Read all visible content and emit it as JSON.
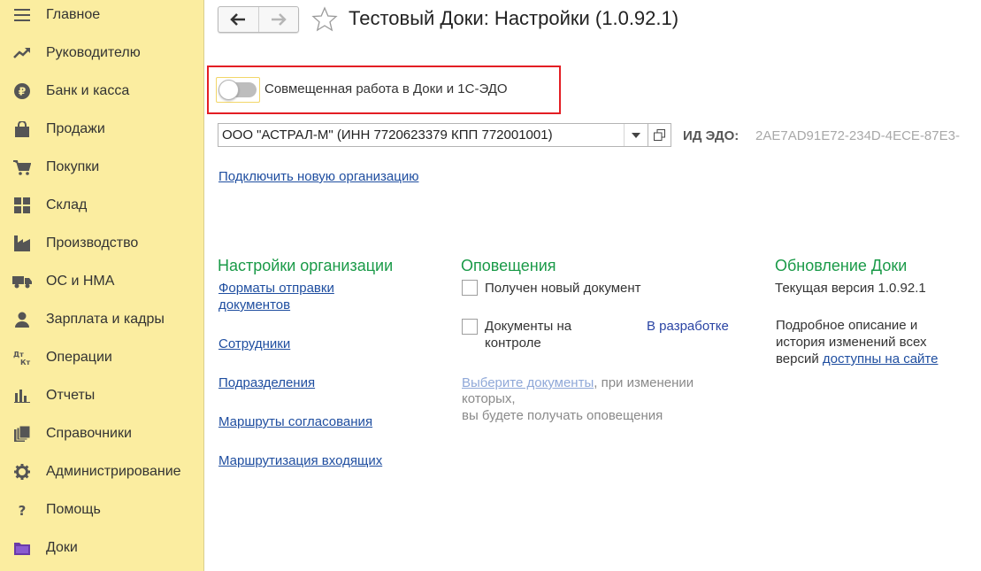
{
  "sidebar": {
    "items": [
      {
        "label": "Главное",
        "icon": "menu-icon"
      },
      {
        "label": "Руководителю",
        "icon": "trend-icon"
      },
      {
        "label": "Банк и касса",
        "icon": "ruble-icon"
      },
      {
        "label": "Продажи",
        "icon": "bag-icon"
      },
      {
        "label": "Покупки",
        "icon": "cart-icon"
      },
      {
        "label": "Склад",
        "icon": "warehouse-icon"
      },
      {
        "label": "Производство",
        "icon": "factory-icon"
      },
      {
        "label": "ОС и НМА",
        "icon": "truck-icon"
      },
      {
        "label": "Зарплата и кадры",
        "icon": "person-icon"
      },
      {
        "label": "Операции",
        "icon": "dt-kt-icon"
      },
      {
        "label": "Отчеты",
        "icon": "bar-chart-icon"
      },
      {
        "label": "Справочники",
        "icon": "books-icon"
      },
      {
        "label": "Администрирование",
        "icon": "gear-icon"
      },
      {
        "label": "Помощь",
        "icon": "question-icon"
      },
      {
        "label": "Доки",
        "icon": "folder-icon"
      }
    ]
  },
  "header": {
    "title": "Тестовый Доки: Настройки (1.0.92.1)"
  },
  "toggle": {
    "label": "Совмещенная работа в Доки и 1С-ЭДО",
    "on": false
  },
  "organization": {
    "value": "ООО \"АСТРАЛ-М\" (ИНН 7720623379 КПП 772001001)",
    "edo_label": "ИД ЭДО:",
    "edo_value": "2AE7AD91E72-234D-4ECE-87E3-"
  },
  "connect_link": "Подключить новую организацию",
  "org_settings": {
    "title": "Настройки организации",
    "links": [
      "Форматы отправки документов",
      "Сотрудники",
      "Подразделения",
      "Маршруты согласования",
      "Маршрутизация входящих"
    ]
  },
  "notifications": {
    "title": "Оповещения",
    "new_doc": "Получен новый документ",
    "on_control": "Документы на контроле",
    "in_dev": "В разработке",
    "choose_link": "Выберите документы",
    "hint_1": ", при изменении",
    "hint_2": "которых,",
    "hint_3": "вы будете получать оповещения"
  },
  "update": {
    "title": "Обновление Доки",
    "current_version": "Текущая версия 1.0.92.1",
    "desc_1": "Подробное описание и",
    "desc_2": "история изменений всех",
    "desc_3": "версий",
    "site_link": "доступны на сайте"
  },
  "colors": {
    "sidebar_bg": "#fbeda0",
    "section_title": "#1a9a48",
    "link": "#1f4ea0",
    "highlight": "#e31e24"
  }
}
